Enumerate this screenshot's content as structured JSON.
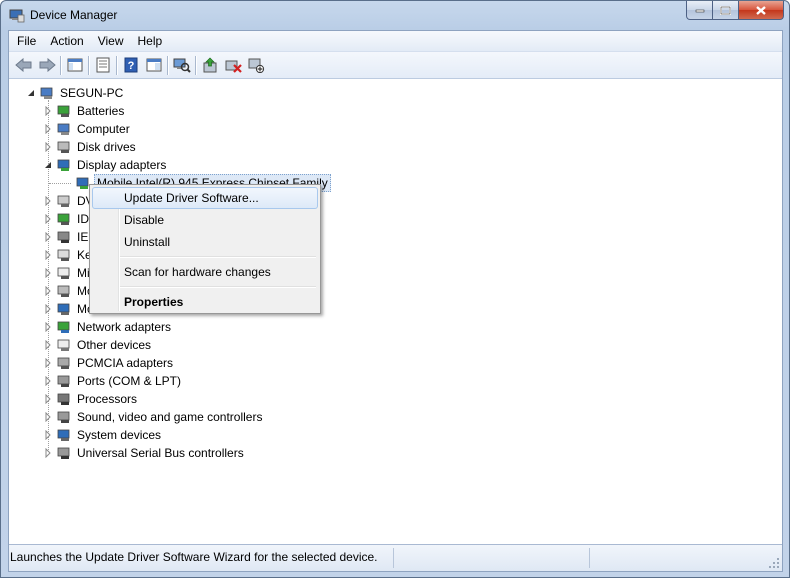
{
  "window": {
    "title": "Device Manager"
  },
  "menu": [
    {
      "label": "File"
    },
    {
      "label": "Action"
    },
    {
      "label": "View"
    },
    {
      "label": "Help"
    }
  ],
  "toolbar": [
    {
      "icon": "back-arrow-icon",
      "name": "back-button"
    },
    {
      "icon": "forward-arrow-icon",
      "name": "forward-button"
    },
    {
      "sep": true
    },
    {
      "icon": "show-hide-console-tree-icon",
      "name": "console-tree-button"
    },
    {
      "sep": true
    },
    {
      "icon": "properties-icon",
      "name": "properties-button"
    },
    {
      "sep": true
    },
    {
      "icon": "help-icon",
      "name": "help-button"
    },
    {
      "icon": "show-action-pane-icon",
      "name": "action-pane-button"
    },
    {
      "sep": true
    },
    {
      "icon": "scan-hardware-icon",
      "name": "scan-hardware-button"
    },
    {
      "sep": true
    },
    {
      "icon": "update-driver-icon",
      "name": "update-driver-button"
    },
    {
      "icon": "uninstall-icon",
      "name": "uninstall-button"
    },
    {
      "icon": "disable-icon",
      "name": "disable-button"
    }
  ],
  "tree": {
    "root": {
      "label": "SEGUN-PC",
      "expanded": true
    },
    "categories": [
      {
        "label": "Batteries",
        "icon": "battery-icon",
        "expanded": false
      },
      {
        "label": "Computer",
        "icon": "computer-icon",
        "expanded": false
      },
      {
        "label": "Disk drives",
        "icon": "disk-drive-icon",
        "expanded": false
      },
      {
        "label": "Display adapters",
        "icon": "display-adapter-icon",
        "expanded": true,
        "children": [
          {
            "label": "Mobile Intel(R) 945 Express Chipset Family",
            "selected": true
          }
        ]
      },
      {
        "label": "DVD/CD-ROM drives",
        "visible_label": "DV",
        "icon": "dvd-icon",
        "expanded": false
      },
      {
        "label": "IDE ATA/ATAPI controllers",
        "visible_label": "IDE",
        "icon": "ide-icon",
        "expanded": false
      },
      {
        "label": "IEEE 1394 Bus host controllers",
        "visible_label": "IEE",
        "icon": "ieee1394-icon",
        "expanded": false
      },
      {
        "label": "Keyboards",
        "visible_label": "Key",
        "icon": "keyboard-icon",
        "expanded": false
      },
      {
        "label": "Mice and other pointing devices",
        "visible_label": "Mic",
        "icon": "mouse-icon",
        "expanded": false
      },
      {
        "label": "Modems",
        "visible_label": "Mo",
        "icon": "modem-icon",
        "expanded": false
      },
      {
        "label": "Monitors",
        "visible_label": "Mo",
        "icon": "monitor-icon",
        "expanded": false
      },
      {
        "label": "Network adapters",
        "icon": "network-adapter-icon",
        "expanded": false
      },
      {
        "label": "Other devices",
        "icon": "other-devices-icon",
        "expanded": false
      },
      {
        "label": "PCMCIA adapters",
        "icon": "pcmcia-icon",
        "expanded": false
      },
      {
        "label": "Ports (COM & LPT)",
        "icon": "ports-icon",
        "expanded": false
      },
      {
        "label": "Processors",
        "icon": "processor-icon",
        "expanded": false
      },
      {
        "label": "Sound, video and game controllers",
        "icon": "sound-icon",
        "expanded": false
      },
      {
        "label": "System devices",
        "icon": "system-devices-icon",
        "expanded": false
      },
      {
        "label": "Universal Serial Bus controllers",
        "icon": "usb-icon",
        "expanded": false
      }
    ]
  },
  "context_menu": {
    "items": [
      {
        "label": "Update Driver Software...",
        "highlighted": true
      },
      {
        "label": "Disable"
      },
      {
        "label": "Uninstall"
      },
      {
        "separator": true
      },
      {
        "label": "Scan for hardware changes"
      },
      {
        "separator": true
      },
      {
        "label": "Properties",
        "bold": true
      }
    ]
  },
  "status": {
    "text": "Launches the Update Driver Software Wizard for the selected device."
  },
  "colors": {
    "selection": "#dde8f6",
    "menu_highlight": "#dde9f8",
    "close_button": "#c4361b"
  }
}
